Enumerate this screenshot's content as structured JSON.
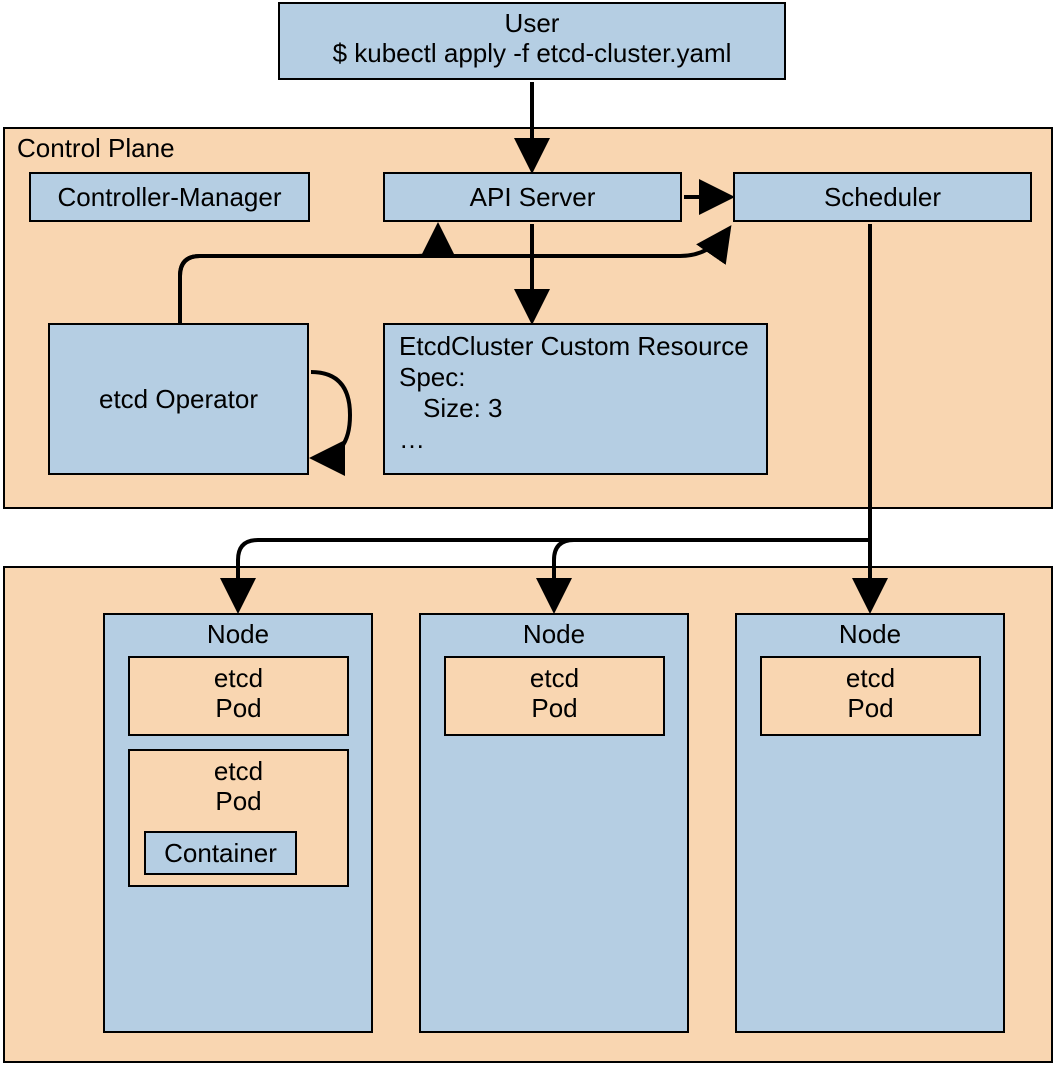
{
  "user": {
    "title": "User",
    "command": "$ kubectl apply -f etcd-cluster.yaml"
  },
  "controlPlane": {
    "title": "Control Plane",
    "controllerManager": "Controller-Manager",
    "apiServer": "API Server",
    "scheduler": "Scheduler",
    "etcdOperator": "etcd Operator",
    "customResource": {
      "title": "EtcdCluster Custom Resource",
      "specLabel": "Spec:",
      "sizeLabel": "Size: 3",
      "ellipsis": "…"
    }
  },
  "workers": {
    "nodeLabel": "Node",
    "etcdPodLine1": "etcd",
    "etcdPodLine2": "Pod",
    "container": "Container"
  }
}
